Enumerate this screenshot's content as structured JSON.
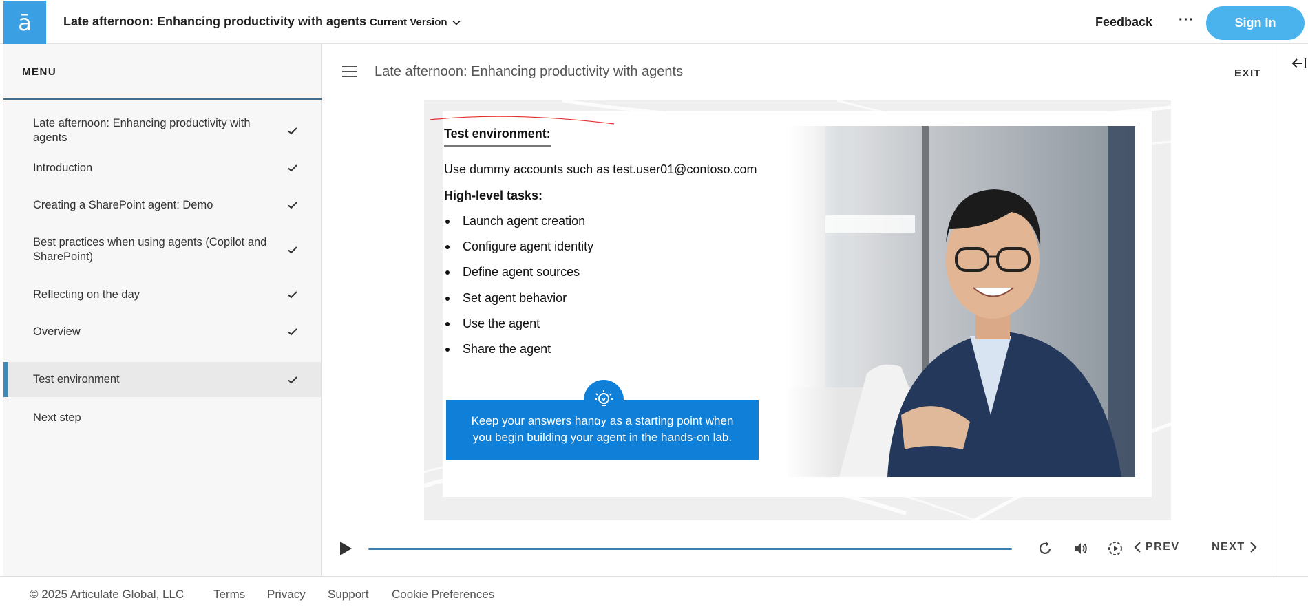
{
  "header": {
    "logo_glyph": "ā",
    "title": "Late afternoon: Enhancing productivity with agents",
    "version_label": "Current Version",
    "feedback_label": "Feedback",
    "more_label": "···",
    "signin_label": "Sign In",
    "accent_color": "#3aa0e3"
  },
  "sidebar": {
    "menu_label": "MENU",
    "items": [
      {
        "label": "Late afternoon: Enhancing productivity with agents",
        "completed": true
      },
      {
        "label": "Introduction",
        "completed": true
      },
      {
        "label": "Creating a SharePoint agent: Demo",
        "completed": true
      },
      {
        "label": "Best practices when using agents (Copilot and SharePoint)",
        "completed": true
      },
      {
        "label": "Reflecting on the day",
        "completed": true
      },
      {
        "label": "Overview",
        "completed": true
      },
      {
        "label": "Test environment",
        "completed": true,
        "active": true
      },
      {
        "label": "Next step",
        "completed": false
      }
    ]
  },
  "main": {
    "lesson_title": "Late afternoon: Enhancing productivity with agents",
    "exit_label": "EXIT",
    "slide": {
      "title": "Test environment:",
      "line": "Use dummy accounts such as test.user01@contoso.com",
      "subheading": "High-level tasks:",
      "tasks": [
        "Launch agent creation",
        "Configure agent identity",
        "Define agent sources",
        "Set agent behavior",
        "Use the agent",
        "Share the agent"
      ],
      "tip_line1": "Keep your answers handy as a starting point when",
      "tip_line2": "you begin building your agent in the hands-on lab.",
      "tip_color": "#0f7fd8"
    },
    "player": {
      "prev_label": "PREV",
      "next_label": "NEXT"
    }
  },
  "footer": {
    "copyright": "© 2025 Articulate Global, LLC",
    "terms": "Terms",
    "privacy": "Privacy",
    "support": "Support",
    "cookies": "Cookie Preferences"
  }
}
